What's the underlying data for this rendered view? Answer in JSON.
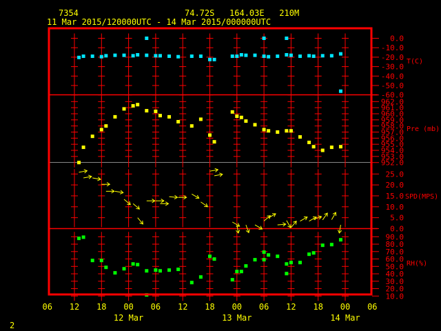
{
  "header": {
    "station": "7354",
    "location": "74.72S   164.03E   210M",
    "period": "11 Mar 2015/120000UTC - 14 Mar 2015/000000UTC"
  },
  "page_number": "2",
  "colors": {
    "axis": "#ff0000",
    "text": "#ffff00",
    "temp": "#00e5ff",
    "pressure": "#ffff00",
    "wind": "#ffff00",
    "rh": "#00ff00"
  },
  "chart_data": {
    "type": "scatter",
    "title": "7354  74.72S 164.03E 210M",
    "subtitle": "11 Mar 2015/120000UTC - 14 Mar 2015/000000UTC",
    "x_unit": "hours since 11 Mar 2015 12UTC",
    "x_ticks": {
      "hours": [
        -6,
        0,
        6,
        12,
        18,
        24,
        30,
        36,
        42,
        48,
        54,
        60,
        66
      ],
      "labels": [
        "06",
        "12",
        "18",
        "00",
        "06",
        "12",
        "18",
        "00",
        "06",
        "12",
        "18",
        "00",
        "06"
      ]
    },
    "x_dates": [
      {
        "hour": 12,
        "label": "12 Mar"
      },
      {
        "hour": 36,
        "label": "13 Mar"
      },
      {
        "hour": 60,
        "label": "14 Mar"
      }
    ],
    "panels": [
      {
        "name": "temperature",
        "label": "T(C)",
        "ylim": [
          -60,
          0
        ],
        "ticks": [
          "0.0",
          "-10.0",
          "-20.0",
          "-30.0",
          "-40.0",
          "-50.0",
          "-60.0"
        ],
        "points": [
          [
            1,
            -20.3
          ],
          [
            2,
            -19
          ],
          [
            4,
            -19
          ],
          [
            6,
            -19.5
          ],
          [
            7,
            -18.5
          ],
          [
            9,
            -18
          ],
          [
            11,
            -18
          ],
          [
            13,
            -18.5
          ],
          [
            14,
            -17.5
          ],
          [
            16,
            -18
          ],
          [
            18,
            -18.5
          ],
          [
            19,
            -18.5
          ],
          [
            21,
            -19
          ],
          [
            23,
            -19.5
          ],
          [
            26,
            -19
          ],
          [
            28,
            -19
          ],
          [
            30,
            -22.5
          ],
          [
            31,
            -22.5
          ],
          [
            35,
            -19
          ],
          [
            36,
            -19
          ],
          [
            37,
            -17.5
          ],
          [
            38,
            -18
          ],
          [
            40,
            -18
          ],
          [
            42,
            -19
          ],
          [
            43,
            -19.5
          ],
          [
            45,
            -19
          ],
          [
            47,
            -17.5
          ],
          [
            48,
            -18
          ],
          [
            50,
            -19
          ],
          [
            52,
            -18.5
          ],
          [
            53,
            -19
          ],
          [
            55,
            -18.5
          ],
          [
            57,
            -18.5
          ],
          [
            59,
            -16.5
          ]
        ],
        "outliers": [
          [
            16,
            0
          ],
          [
            42,
            0
          ],
          [
            47,
            0
          ],
          [
            59,
            -56
          ]
        ]
      },
      {
        "name": "pressure",
        "label": "Pre (mb)",
        "ylim": [
          952,
          962
        ],
        "ticks": [
          "962.0",
          "961.0",
          "960.0",
          "959.0",
          "958.0",
          "957.0",
          "956.0",
          "955.0",
          "954.0",
          "953.0",
          "952.0"
        ],
        "points": [
          [
            1,
            952
          ],
          [
            2,
            954.5
          ],
          [
            4,
            956.3
          ],
          [
            6,
            957.4
          ],
          [
            7,
            958.0
          ],
          [
            9,
            959.5
          ],
          [
            11,
            960.8
          ],
          [
            13,
            961.3
          ],
          [
            14,
            961.5
          ],
          [
            16,
            960.5
          ],
          [
            18,
            960.4
          ],
          [
            19,
            959.7
          ],
          [
            21,
            959.5
          ],
          [
            23,
            958.7
          ],
          [
            26,
            958.0
          ],
          [
            28,
            959.1
          ],
          [
            30,
            956.5
          ],
          [
            31,
            955.4
          ],
          [
            35,
            960.3
          ],
          [
            36,
            959.6
          ],
          [
            37,
            959.4
          ],
          [
            38,
            958.8
          ],
          [
            40,
            958.2
          ],
          [
            42,
            957.4
          ],
          [
            43,
            957.2
          ],
          [
            45,
            957.0
          ],
          [
            47,
            957.2
          ],
          [
            48,
            957.2
          ],
          [
            50,
            956.2
          ],
          [
            52,
            955.3
          ],
          [
            53,
            954.6
          ],
          [
            55,
            954.0
          ],
          [
            57,
            954.5
          ],
          [
            59,
            954.6
          ]
        ]
      },
      {
        "name": "wind",
        "label": "SPD(MPS)",
        "ylim": [
          0,
          25
        ],
        "ticks": [
          "25.0",
          "20.0",
          "15.0",
          "10.0",
          "5.0",
          "0.0"
        ],
        "points_hour_speed_dir": [
          [
            1,
            25.8,
            260
          ],
          [
            2,
            23.2,
            260
          ],
          [
            4,
            23.2,
            280
          ],
          [
            6,
            20.3,
            270
          ],
          [
            7,
            17.1,
            270
          ],
          [
            9,
            17.1,
            280
          ],
          [
            11,
            13.4,
            310
          ],
          [
            13,
            11.4,
            310
          ],
          [
            14,
            5.0,
            320
          ],
          [
            16,
            12.7,
            270
          ],
          [
            18,
            12.7,
            270
          ],
          [
            19,
            11.4,
            270
          ],
          [
            21,
            14.6,
            275
          ],
          [
            23,
            14.3,
            270
          ],
          [
            26,
            15.8,
            300
          ],
          [
            28,
            12.2,
            305
          ],
          [
            30,
            26.3,
            260
          ],
          [
            31,
            24.2,
            260
          ],
          [
            35,
            3.0,
            300
          ],
          [
            36,
            1.7,
            350
          ],
          [
            38,
            1.7,
            340
          ],
          [
            40,
            1.7,
            300
          ],
          [
            42,
            3.5,
            230
          ],
          [
            43,
            4.9,
            240
          ],
          [
            45,
            1.7,
            265
          ],
          [
            47,
            3.7,
            330
          ],
          [
            48,
            0.5,
            220
          ],
          [
            50,
            3.4,
            240
          ],
          [
            52,
            3.4,
            240
          ],
          [
            53,
            4.2,
            250
          ],
          [
            55,
            4.0,
            215
          ],
          [
            57,
            4.1,
            210
          ],
          [
            59,
            1.7,
            10
          ]
        ]
      },
      {
        "name": "rh",
        "label": "RH(%)",
        "ylim": [
          10,
          90
        ],
        "ticks": [
          "90.0",
          "80.0",
          "70.0",
          "60.0",
          "50.0",
          "40.0",
          "30.0",
          "20.0",
          "10.0"
        ],
        "points": [
          [
            1,
            87.8
          ],
          [
            2,
            89.4
          ],
          [
            4,
            58
          ],
          [
            6,
            58
          ],
          [
            7,
            48.7
          ],
          [
            9,
            41.3
          ],
          [
            11,
            46.8
          ],
          [
            13,
            53.3
          ],
          [
            14,
            52.4
          ],
          [
            16,
            44
          ],
          [
            18,
            45
          ],
          [
            19,
            44
          ],
          [
            21,
            45
          ],
          [
            23,
            46
          ],
          [
            26,
            28.2
          ],
          [
            28,
            35.7
          ],
          [
            30,
            63.6
          ],
          [
            31,
            59.9
          ],
          [
            35,
            32
          ],
          [
            36,
            43.1
          ],
          [
            37,
            43.1
          ],
          [
            38,
            50.6
          ],
          [
            40,
            59
          ],
          [
            42,
            59
          ],
          [
            43,
            65.4
          ],
          [
            45,
            63.6
          ],
          [
            47,
            53.3
          ],
          [
            48,
            55.2
          ],
          [
            50,
            55.2
          ],
          [
            52,
            66.4
          ],
          [
            53,
            68.2
          ],
          [
            55,
            78.5
          ],
          [
            57,
            79.4
          ],
          [
            59,
            85.9
          ]
        ],
        "outliers": [
          [
            16,
            11.5
          ],
          [
            42,
            69.2
          ],
          [
            47,
            40.3
          ]
        ]
      }
    ]
  }
}
